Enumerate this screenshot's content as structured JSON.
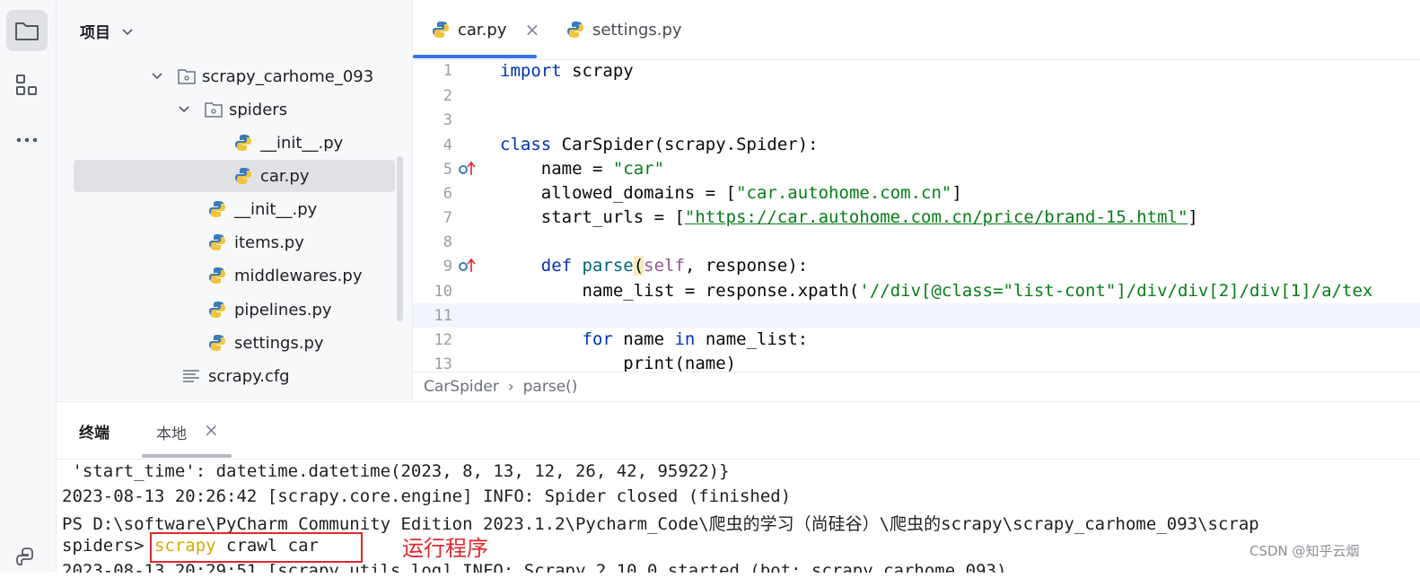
{
  "activity_bar": {
    "icons": [
      "folder-icon",
      "structure-icon",
      "more-icon",
      "python-console-icon"
    ]
  },
  "project_panel": {
    "title": "项目",
    "tree": [
      {
        "label": "scrapy_carhome_093",
        "type": "package"
      },
      {
        "label": "spiders",
        "type": "package"
      },
      {
        "label": "__init__.py",
        "type": "python"
      },
      {
        "label": "car.py",
        "type": "python",
        "selected": true
      },
      {
        "label": "__init__.py",
        "type": "python"
      },
      {
        "label": "items.py",
        "type": "python"
      },
      {
        "label": "middlewares.py",
        "type": "python"
      },
      {
        "label": "pipelines.py",
        "type": "python"
      },
      {
        "label": "settings.py",
        "type": "python"
      },
      {
        "label": "scrapy.cfg",
        "type": "text"
      }
    ]
  },
  "editor": {
    "tabs": [
      {
        "label": "car.py",
        "active": true,
        "close": "×"
      },
      {
        "label": "settings.py",
        "active": false
      }
    ],
    "line_numbers": [
      "1",
      "2",
      "3",
      "4",
      "5",
      "6",
      "7",
      "8",
      "9",
      "10",
      "11",
      "12",
      "13"
    ],
    "code": {
      "l1_kw": "import",
      "l1_rest": " scrapy",
      "l4_kw": "class",
      "l4_rest": " CarSpider(scrapy.Spider):",
      "l5_a": "    name = ",
      "l5_str": "\"car\"",
      "l6_a": "    allowed_domains = [",
      "l6_str": "\"car.autohome.com.cn\"",
      "l6_b": "]",
      "l7_a": "    start_urls = [",
      "l7_str": "\"https://car.autohome.com.cn/price/brand-15.html\"",
      "l7_b": "]",
      "l9_kw": "    def",
      "l9_fn": " parse",
      "l9_p1": "(",
      "l9_self": "self",
      "l9_p2": ", response):",
      "l10_a": "        name_list = response.xpath(",
      "l10_str": "'//div[@class=\"list-cont\"]/div/div[2]/div[1]/a/tex",
      "l12_kw1": "        for",
      "l12_a": " name ",
      "l12_kw2": "in",
      "l12_b": " name_list:",
      "l13": "            print(name)"
    },
    "breadcrumb": [
      "CarSpider",
      "parse()"
    ],
    "breadcrumb_sep": "›"
  },
  "terminal": {
    "title": "终端",
    "tab": "本地",
    "tab_close": "×",
    "lines": [
      " 'start_time': datetime.datetime(2023, 8, 13, 12, 26, 42, 95922)}",
      "2023-08-13 20:26:42 [scrapy.core.engine] INFO: Spider closed (finished)",
      "PS D:\\software\\PyCharm Community Edition 2023.1.2\\Pycharm_Code\\爬虫的学习（尚硅谷）\\爬虫的scrapy\\scrapy_carhome_093\\scrap"
    ],
    "prompt": "spiders>",
    "cmd_1": " scrapy",
    "cmd_2": " crawl car",
    "partial_line": "2023-08-13 20:29:51 [scrapy.utils.log] INFO: Scrapy 2.10.0 started (bot: scrapy_carhome_093)"
  },
  "annotation": "运行程序",
  "watermark": "CSDN @知乎云烟",
  "colors": {
    "accent": "#3574f0",
    "annotation_red": "#e0282e",
    "keyword": "#0033b3",
    "string": "#067d17",
    "scrapy_cmd": "#d7a900"
  }
}
